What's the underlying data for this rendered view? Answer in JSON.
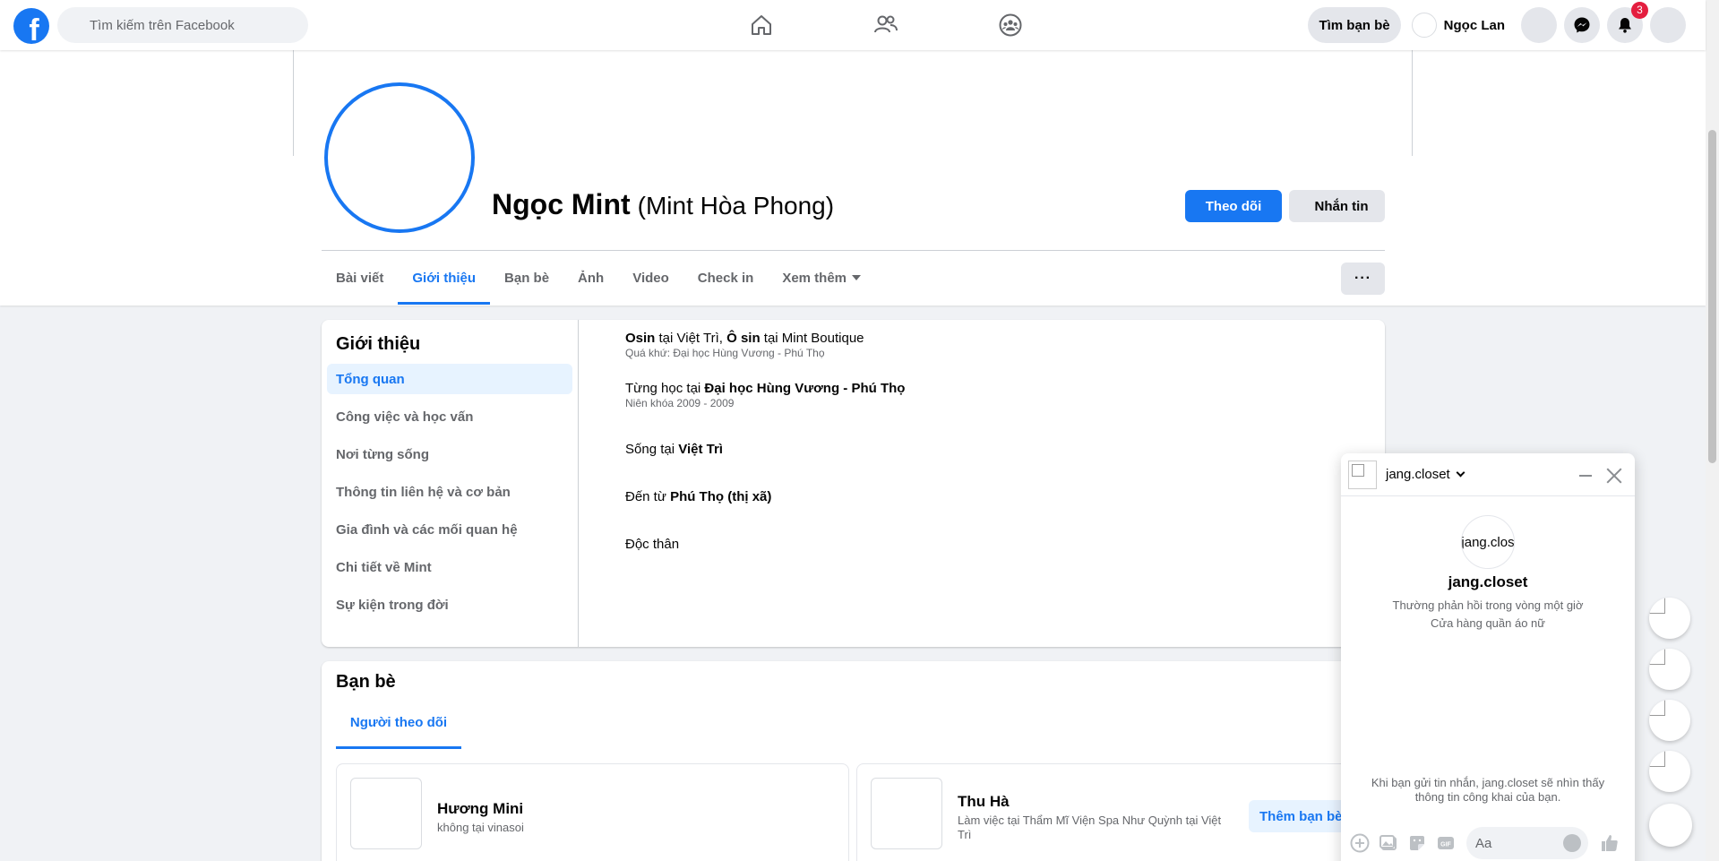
{
  "topbar": {
    "logo": "f",
    "search_placeholder": "Tìm kiếm trên Facebook",
    "find_friends": "Tìm bạn bè",
    "user_name": "Ngọc Lan",
    "notification_count": "3",
    "accent": "#1877f2"
  },
  "profile": {
    "name": "Ngọc Mint",
    "alt_name": "(Mint Hòa Phong)",
    "follow_label": "Theo dõi",
    "message_label": "Nhắn tin",
    "more_label": "···"
  },
  "tabs": [
    {
      "label": "Bài viết"
    },
    {
      "label": "Giới thiệu"
    },
    {
      "label": "Bạn bè"
    },
    {
      "label": "Ảnh"
    },
    {
      "label": "Video"
    },
    {
      "label": "Check in"
    },
    {
      "label": "Xem thêm"
    }
  ],
  "intro": {
    "title": "Giới thiệu",
    "menu": [
      {
        "label": "Tổng quan"
      },
      {
        "label": "Công việc và học vấn"
      },
      {
        "label": "Nơi từng sống"
      },
      {
        "label": "Thông tin liên hệ và cơ bản"
      },
      {
        "label": "Gia đình và các mối quan hệ"
      },
      {
        "label": "Chi tiết về Mint"
      },
      {
        "label": "Sự kiện trong đời"
      }
    ],
    "work": {
      "job1": "Osin",
      "at1": " tại Việt Trì, ",
      "job2": "Ô sin",
      "at2": " tại Mint Boutique",
      "past": "Quá khứ: Đại học Hùng Vương - Phú Thọ"
    },
    "education": {
      "prefix": "Từng học tại ",
      "school": "Đại học Hùng Vương - Phú Thọ",
      "years": "Niên khóa 2009 - 2009"
    },
    "lives": {
      "prefix": "Sống tại ",
      "place": "Việt Trì"
    },
    "from": {
      "prefix": "Đến từ ",
      "place": "Phú Thọ (thị xã)"
    },
    "relationship": "Độc thân"
  },
  "friends": {
    "title": "Bạn bè",
    "tab_label": "Người theo dõi",
    "items": [
      {
        "name": "Hương Mini",
        "sub": "không tại vinasoi"
      },
      {
        "name": "Thu Hà",
        "sub": "Làm việc tại Thẩm Mĩ Viện Spa Như Quỳnh tại Việt Trì",
        "action": "Thêm bạn bè"
      }
    ]
  },
  "chat": {
    "name": "jang.closet",
    "avatar_text": "jang.clos",
    "response": "Thường phản hồi trong vòng một giờ",
    "category": "Cửa hàng quần áo nữ",
    "note": "Khi bạn gửi tin nhắn, jang.closet sẽ nhìn thấy thông tin công khai của bạn.",
    "input_placeholder": "Aa",
    "gif_label": "GIF"
  }
}
